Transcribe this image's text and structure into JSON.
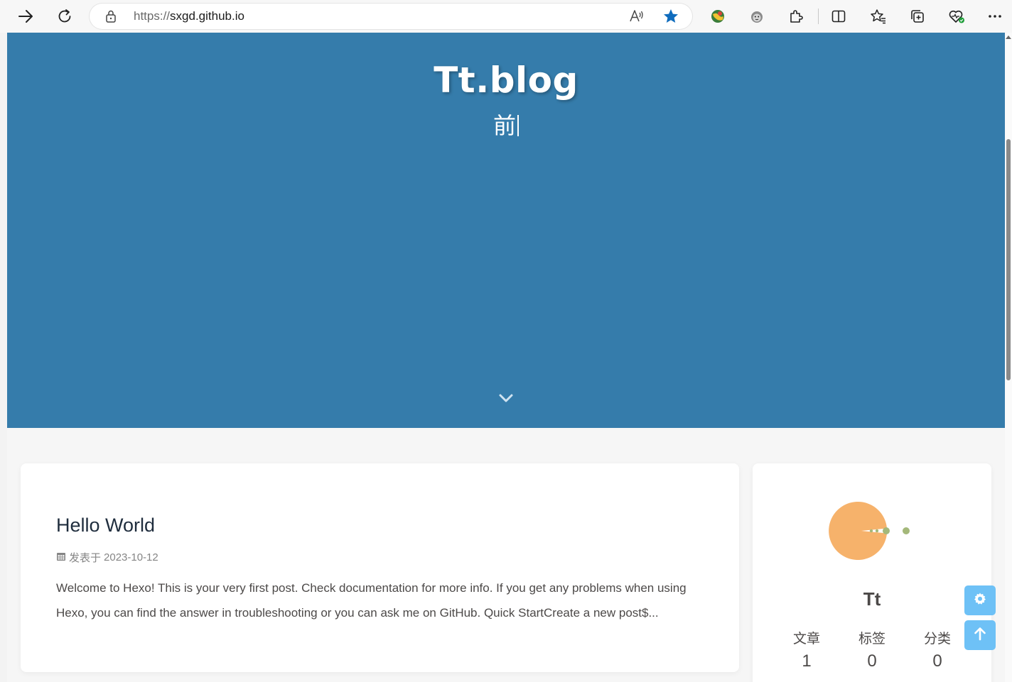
{
  "browser": {
    "url_protocol": "https://",
    "url_host": "sxgd.github.io",
    "icons": [
      "back-icon",
      "refresh-icon",
      "lock-icon",
      "read-aloud-icon",
      "favorite-star-icon",
      "extension-globe-icon",
      "extension-monkey-icon",
      "extensions-icon",
      "split-screen-icon",
      "favorites-icon",
      "collections-icon",
      "browser-essentials-icon",
      "more-icon"
    ]
  },
  "hero": {
    "title": "Tt.blog",
    "subtitle": "前",
    "background": "#357cab"
  },
  "post": {
    "title": "Hello World",
    "meta_label": "发表于",
    "date": "2023-10-12",
    "excerpt": "Welcome to Hexo! This is your very first post. Check documentation for more info. If you get any problems when using Hexo, you can find the answer in troubleshooting or you can ask me on GitHub. Quick StartCreate a new post$..."
  },
  "sidebar": {
    "author": "Tt",
    "stats": [
      {
        "label": "文章",
        "value": "1"
      },
      {
        "label": "标签",
        "value": "0"
      },
      {
        "label": "分类",
        "value": "0"
      }
    ]
  },
  "colors": {
    "accent": "#6ec1f6",
    "avatar_orange": "#f6b26b",
    "avatar_dot": "#a4b87a"
  }
}
